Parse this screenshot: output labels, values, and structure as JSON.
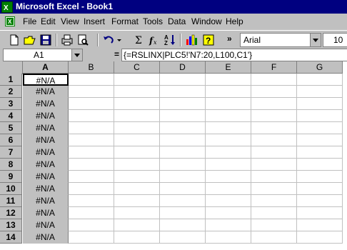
{
  "window": {
    "title": "Microsoft Excel - Book1"
  },
  "menu": [
    {
      "label": "File"
    },
    {
      "label": "Edit"
    },
    {
      "label": "View"
    },
    {
      "label": "Insert"
    },
    {
      "label": "Format"
    },
    {
      "label": "Tools"
    },
    {
      "label": "Data"
    },
    {
      "label": "Window"
    },
    {
      "label": "Help"
    }
  ],
  "toolbar": {
    "font": "Arial",
    "size": "10",
    "more": "»"
  },
  "formula_bar": {
    "name_box": "A1",
    "equals": "=",
    "formula": "{=RSLINX|PLC5!'N7:20,L100,C1'}"
  },
  "sheet": {
    "columns": [
      "A",
      "B",
      "C",
      "D",
      "E",
      "F",
      "G"
    ],
    "rows": [
      "1",
      "2",
      "3",
      "4",
      "5",
      "6",
      "7",
      "8",
      "9",
      "10",
      "11",
      "12",
      "13",
      "14"
    ],
    "col_a_values": [
      "#N/A",
      "#N/A",
      "#N/A",
      "#N/A",
      "#N/A",
      "#N/A",
      "#N/A",
      "#N/A",
      "#N/A",
      "#N/A",
      "#N/A",
      "#N/A",
      "#N/A",
      "#N/A"
    ]
  },
  "colors": {
    "titlebar": "#000080",
    "chrome": "#c0c0c0"
  }
}
